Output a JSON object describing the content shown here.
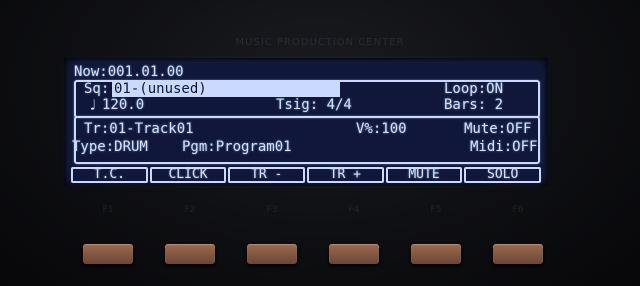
{
  "display": {
    "now": "Now:001.01.00",
    "sequence": {
      "label": "Sq:",
      "value": "01-(unused)"
    },
    "loop": "Loop:ON",
    "tempo": "120.0",
    "tsig": "Tsig: 4/4",
    "bars": "Bars: 2",
    "track": "Tr:01-Track01",
    "velocity": "V%:100",
    "mute": "Mute:OFF",
    "type": "Type:DRUM",
    "program": "Pgm:Program01",
    "midi": "Midi:OFF",
    "softkeys": [
      "T.C.",
      "CLICK",
      "TR -",
      "TR +",
      "MUTE",
      "SOLO"
    ]
  },
  "hardware": {
    "function_labels": [
      "F1",
      "F2",
      "F3",
      "F4",
      "F5",
      "F6"
    ]
  }
}
